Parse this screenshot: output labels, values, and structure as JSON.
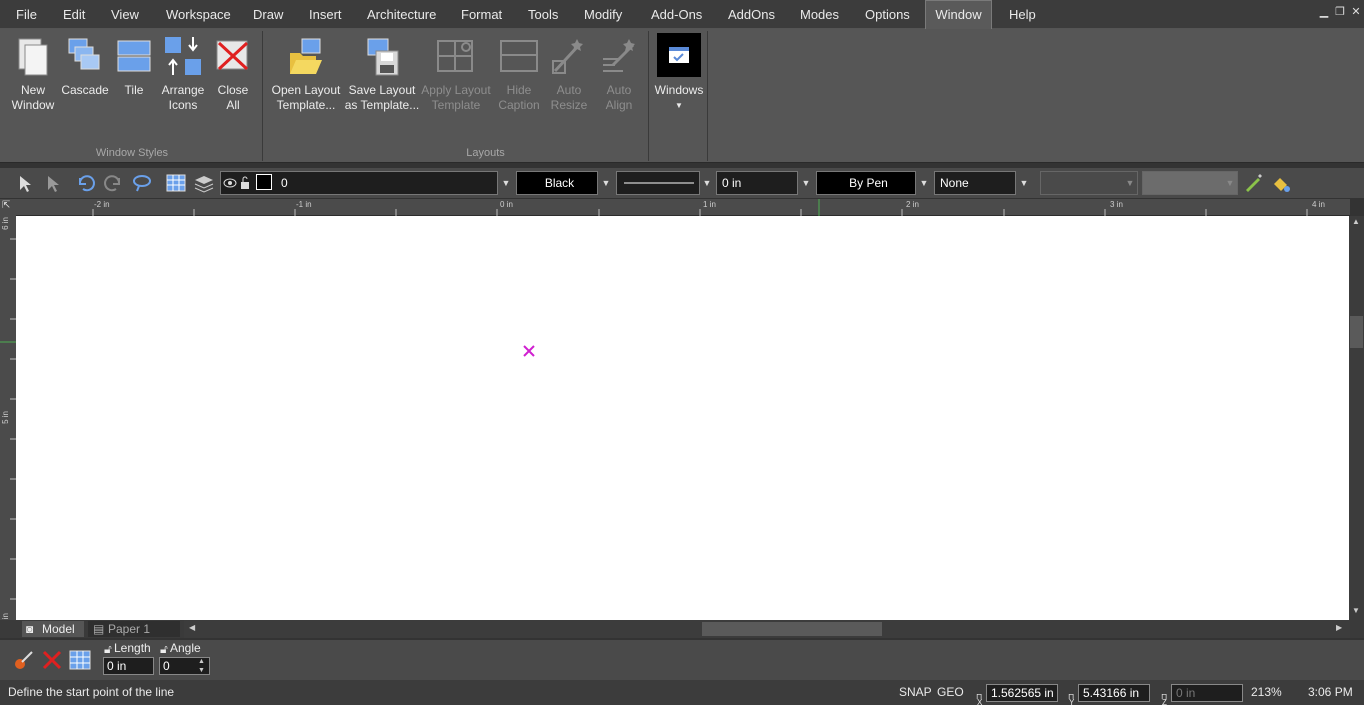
{
  "menu": {
    "items": [
      "File",
      "Edit",
      "View",
      "Workspace",
      "Draw",
      "Insert",
      "Architecture",
      "Format",
      "Tools",
      "Modify",
      "Add-Ons",
      "AddOns",
      "Modes",
      "Options",
      "Window",
      "Help"
    ],
    "active": "Window"
  },
  "ribbon": {
    "window_styles": {
      "label": "Window Styles",
      "new_window": [
        "New",
        "Window"
      ],
      "cascade": [
        "Cascade"
      ],
      "tile": [
        "Tile"
      ],
      "arrange_icons": [
        "Arrange",
        "Icons"
      ],
      "close_all": [
        "Close",
        "All"
      ]
    },
    "layouts": {
      "label": "Layouts",
      "open_layout_template": [
        "Open Layout",
        "Template..."
      ],
      "save_layout_template": [
        "Save Layout",
        "as Template..."
      ],
      "apply_layout_template": [
        "Apply Layout",
        "Template"
      ],
      "hide_caption": [
        "Hide",
        "Caption"
      ],
      "auto_resize": [
        "Auto",
        "Resize"
      ],
      "auto_align": [
        "Auto",
        "Align"
      ]
    },
    "windows": {
      "label": "Windows"
    }
  },
  "toolbar": {
    "layer_value": "0",
    "pen_color": "Black",
    "line_width": "0 in",
    "pen_style": "By Pen",
    "fill": "None"
  },
  "ruler": {
    "top_ticks": [
      "-2 in",
      "-1 in",
      "0 in",
      "1 in",
      "2 in",
      "3 in",
      "4 in"
    ],
    "left_ticks": [
      "6 in",
      "5 in",
      "4 in"
    ]
  },
  "tabs": {
    "model": "Model",
    "paper": "Paper 1"
  },
  "bottom": {
    "length_label": "Length",
    "length_value": "0 in",
    "angle_label": "Angle",
    "angle_value": "0"
  },
  "status": {
    "prompt": "Define the start point of the line",
    "snap": "SNAP",
    "geo": "GEO",
    "x_value": "1.562565 in",
    "y_value": "5.43166 in",
    "z_value": "0 in",
    "zoom": "213%",
    "time": "3:06 PM",
    "x_axis": "X",
    "y_axis": "Y",
    "z_axis": "Z"
  },
  "colors": {
    "accent": "#4a90e2",
    "cursor_marker": "#d020d0"
  }
}
